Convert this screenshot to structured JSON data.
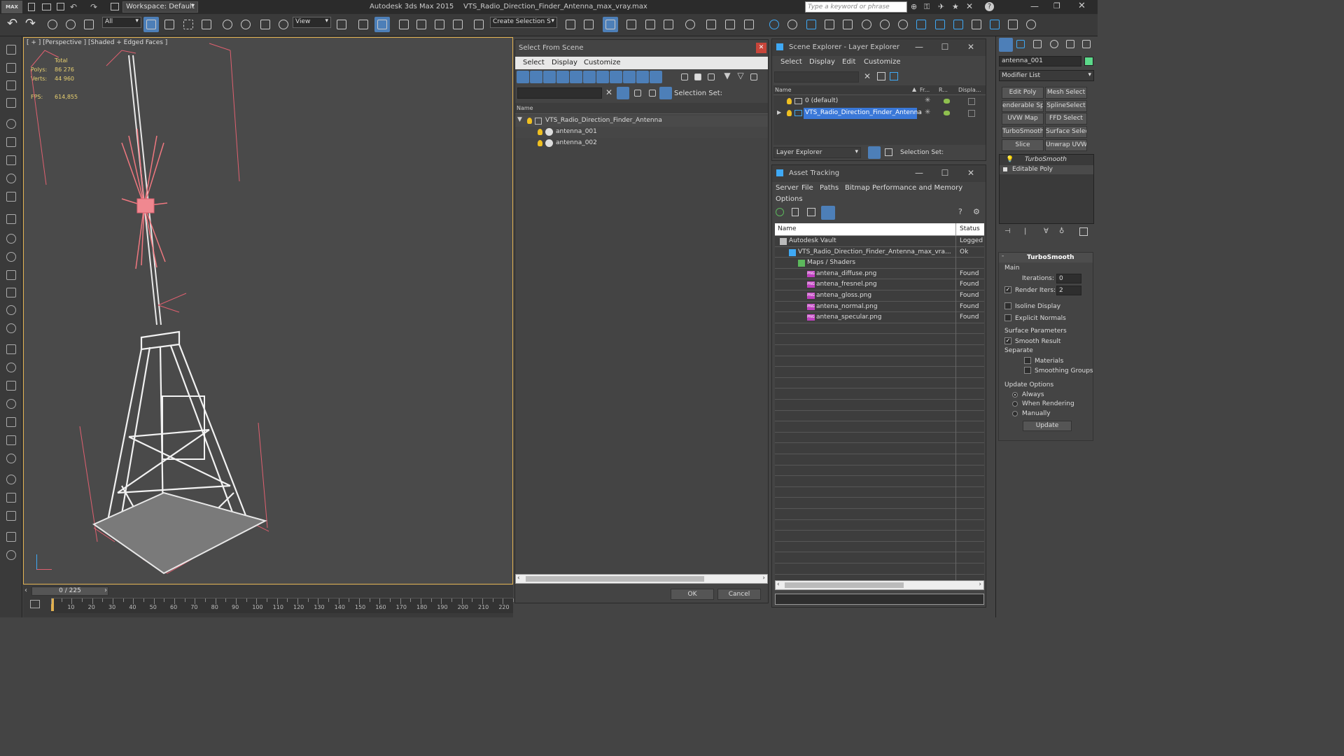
{
  "titlebar": {
    "workspace": "Workspace: Default",
    "app_title": "Autodesk 3ds Max  2015",
    "file_title": "VTS_Radio_Direction_Finder_Antenna_max_vray.max",
    "search_placeholder": "Type a keyword or phrase",
    "logo": "MAX"
  },
  "toolbar": {
    "filter_value": "All",
    "refcoord_value": "View",
    "selection_set_placeholder": "Create Selection Se"
  },
  "viewport": {
    "label": "[ + ] [Perspective ] [Shaded + Edged Faces ]",
    "stats_total": "Total",
    "polys_label": "Polys:",
    "polys_value": "86 276",
    "verts_label": "Verts:",
    "verts_value": "44 960",
    "fps_label": "FPS:",
    "fps_value": "614,855"
  },
  "timeline": {
    "frame": "0 / 225",
    "ticks": [
      "10",
      "20",
      "30",
      "40",
      "50",
      "60",
      "70",
      "80",
      "90",
      "100",
      "110",
      "120",
      "130",
      "140",
      "150",
      "160",
      "170",
      "180",
      "190",
      "200",
      "210",
      "220"
    ]
  },
  "select_from_scene": {
    "title": "Select From Scene",
    "menus": [
      "Select",
      "Display",
      "Customize"
    ],
    "selection_set_label": "Selection Set:",
    "column_name": "Name",
    "items": [
      {
        "name": "VTS_Radio_Direction_Finder_Antenna",
        "level": 0
      },
      {
        "name": "antenna_001",
        "level": 1
      },
      {
        "name": "antenna_002",
        "level": 1
      }
    ],
    "ok": "OK",
    "cancel": "Cancel"
  },
  "scene_explorer": {
    "title": "Scene Explorer - Layer Explorer",
    "menus": [
      "Select",
      "Display",
      "Edit",
      "Customize"
    ],
    "columns": [
      "Name",
      "Fr...",
      "R...",
      "Displa..."
    ],
    "rows": [
      {
        "name": "0 (default)",
        "selected": false
      },
      {
        "name": "VTS_Radio_Direction_Finder_Antenna",
        "selected": true
      }
    ],
    "explorer_dropdown": "Layer Explorer",
    "selection_set_label": "Selection Set:"
  },
  "asset_tracking": {
    "title": "Asset Tracking",
    "menus": [
      "Server",
      "File",
      "Paths",
      "Bitmap Performance and Memory"
    ],
    "menus2": [
      "Options"
    ],
    "col_name": "Name",
    "col_status": "Status",
    "rows": [
      {
        "name": "Autodesk Vault",
        "status": "Logged",
        "indent": 0,
        "icon": "vault"
      },
      {
        "name": "VTS_Radio_Direction_Finder_Antenna_max_vra...",
        "status": "Ok",
        "indent": 1,
        "icon": "max"
      },
      {
        "name": "Maps / Shaders",
        "status": "",
        "indent": 2,
        "icon": "maps"
      },
      {
        "name": "antena_diffuse.png",
        "status": "Found",
        "indent": 3,
        "icon": "png"
      },
      {
        "name": "antena_fresnel.png",
        "status": "Found",
        "indent": 3,
        "icon": "png"
      },
      {
        "name": "antena_gloss.png",
        "status": "Found",
        "indent": 3,
        "icon": "png"
      },
      {
        "name": "antena_normal.png",
        "status": "Found",
        "indent": 3,
        "icon": "png"
      },
      {
        "name": "antena_specular.png",
        "status": "Found",
        "indent": 3,
        "icon": "png"
      }
    ]
  },
  "command_panel": {
    "object_name": "antenna_001",
    "modifier_list": "Modifier List",
    "modifier_buttons": [
      "Edit Poly",
      "Mesh Select",
      "enderable Splir",
      "SplineSelect",
      "UVW Map",
      "FFD Select",
      "TurboSmooth",
      "Surface Select",
      "Slice",
      "Unwrap UVW"
    ],
    "stack": [
      "TurboSmooth",
      "Editable Poly"
    ],
    "rollout_title": "TurboSmooth",
    "main_label": "Main",
    "iterations_label": "Iterations:",
    "iterations_value": "0",
    "render_iters_label": "Render Iters:",
    "render_iters_value": "2",
    "isoline_label": "Isoline Display",
    "explicit_normals_label": "Explicit Normals",
    "surface_params_label": "Surface Parameters",
    "smooth_result_label": "Smooth Result",
    "separate_label": "Separate",
    "materials_label": "Materials",
    "smoothing_groups_label": "Smoothing Groups",
    "update_options_label": "Update Options",
    "always_label": "Always",
    "when_rendering_label": "When Rendering",
    "manually_label": "Manually",
    "update_button": "Update"
  },
  "colors": {
    "accent": "#4d7fb8",
    "selection": "#3a78d8",
    "viewport_border": "#e0b050",
    "stats": "#e8d070",
    "bbox": "#e06070"
  }
}
